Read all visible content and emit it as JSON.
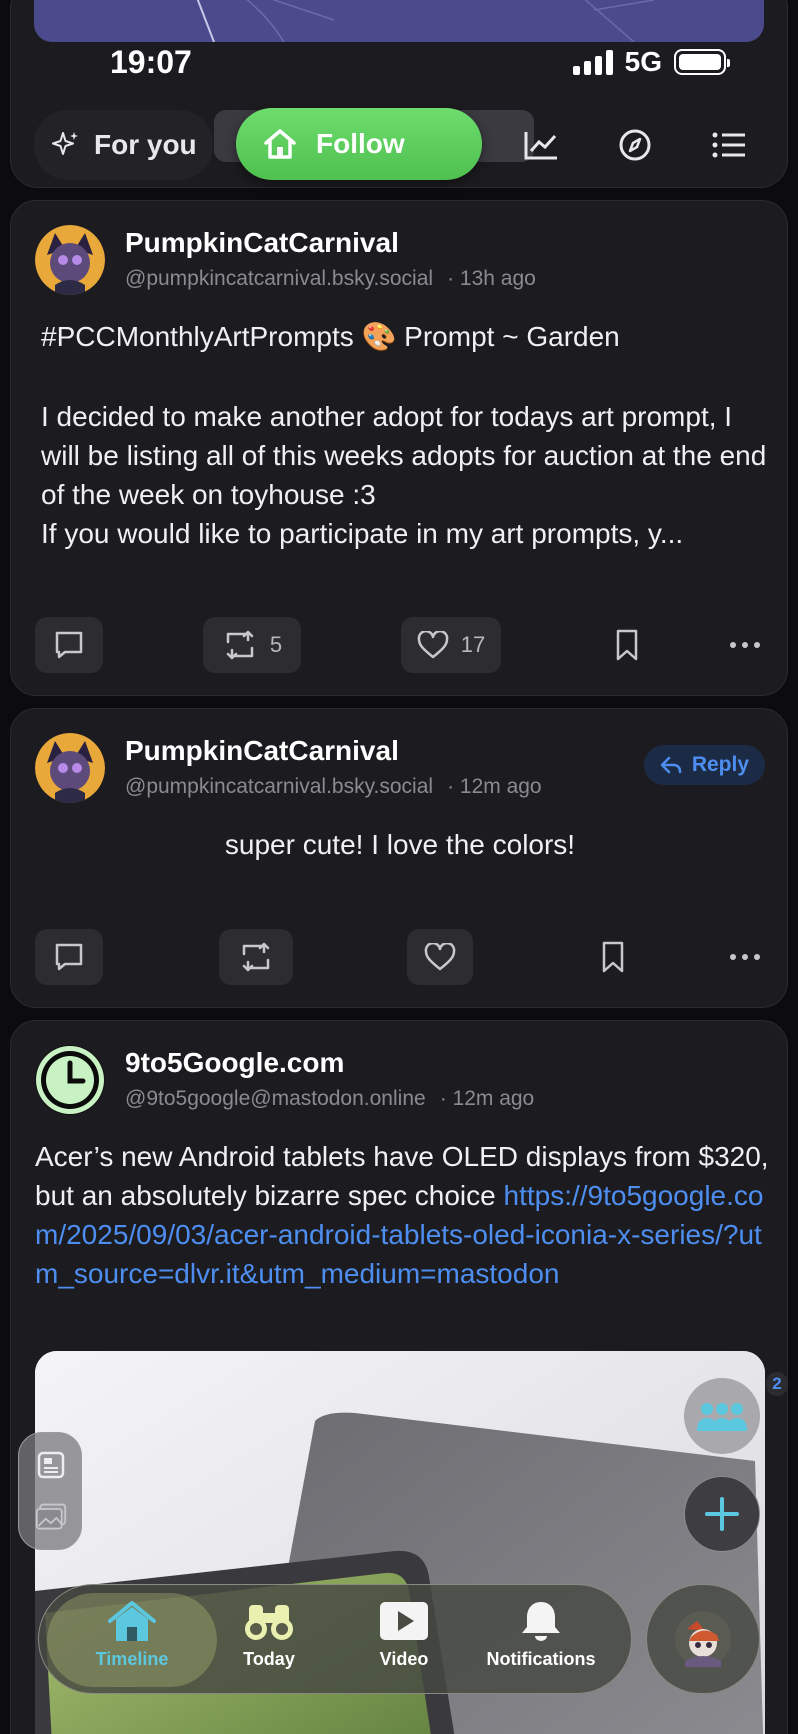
{
  "status_bar": {
    "time": "19:07",
    "network": "5G"
  },
  "feed_tabs": {
    "for_you": "For you",
    "follow": "Follow"
  },
  "posts": [
    {
      "author": "PumpkinCatCarnival",
      "handle": "@pumpkincatcarnival.bsky.social",
      "time": "· 13h ago",
      "text_line1": "#PCCMonthlyArtPrompts 🎨 Prompt ~ Garden",
      "text_body": "I decided to make another adopt for todays art prompt, I will be listing all of this weeks adopts for auction at the end of the week on toyhouse :3",
      "text_trunc": "If you would like to participate in my art prompts, y...",
      "reposts": "5",
      "likes": "17"
    },
    {
      "author": "PumpkinCatCarnival",
      "handle": "@pumpkincatcarnival.bsky.social",
      "time": "· 12m ago",
      "reply_label": "Reply",
      "text": "super cute! I love the colors!"
    },
    {
      "author": "9to5Google.com",
      "handle": "@9to5google@mastodon.online",
      "time": "· 12m ago",
      "text": "Acer’s new Android tablets have OLED displays from $320, but an absolutely bizarre spec choice ",
      "link": "https://9to5google.com/2025/09/03/acer-android-tablets-oled-iconia-x-series/?utm_source=dlvr.it&utm_medium=mastodon"
    }
  ],
  "floating": {
    "group_badge": "2"
  },
  "tab_bar": {
    "items": [
      {
        "label": "Timeline",
        "icon": "house-icon",
        "active": true
      },
      {
        "label": "Today",
        "icon": "binoculars-icon"
      },
      {
        "label": "Video",
        "icon": "play-icon"
      },
      {
        "label": "Notifications",
        "icon": "bell-icon"
      }
    ]
  },
  "colors": {
    "accent": "#4d8ef0",
    "follow_green": "#5fcf5f",
    "timeline_active": "#5bc8e0"
  }
}
